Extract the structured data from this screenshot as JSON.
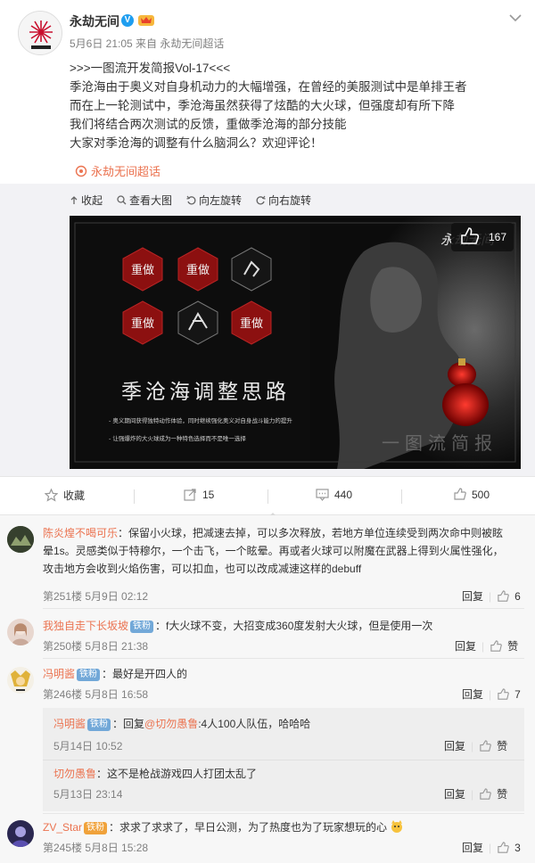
{
  "post": {
    "author": "永劫无间",
    "verified": "V",
    "meta": "5月6日 21:05 来自 永劫无间超话",
    "lines": [
      ">>>一图流开发简报Vol-17<<<",
      "季沧海由于奥义对自身机动力的大幅增强，在曾经的美服测试中是单排王者",
      "而在上一轮测试中，季沧海虽然获得了炫酷的大火球，但强度却有所下降",
      "我们将结合两次测试的反馈，重做季沧海的部分技能",
      "大家对季沧海的调整有什么脑洞么？欢迎评论！"
    ],
    "chaohua_link": "永劫无间超话"
  },
  "media": {
    "tools": [
      "收起",
      "查看大图",
      "向左旋转",
      "向右旋转"
    ],
    "like_count": "167",
    "badges": [
      "重做",
      "重做",
      "重做",
      "重做"
    ],
    "image_title": "季沧海调整思路",
    "bullets": [
      "- 奥义期间获得独特动作体验，同时继续强化奥义对自身战斗能力的提升",
      "- 让强爆炸的大火球成为一种特色选择而不是唯一选择"
    ],
    "watermark": "一图流简报",
    "logo_text": "永劫无间"
  },
  "actions": {
    "collect": "收藏",
    "forward": "15",
    "comment": "440",
    "like": "500"
  },
  "comments": [
    {
      "user": "陈炎煌不喝可乐",
      "text": "：保留小火球，把减速去掉，可以多次释放，若地方单位连续受到两次命中则被眩晕1s。灵感类似于特穆尔，一个击飞，一个眩晕。再或者火球可以附魔在武器上得到火属性强化，攻击地方会收到火焰伤害，可以扣血，也可以改成减速这样的debuff",
      "lines": [
        "：保留小火球，把减速去掉，可以多次释放，若地方单位连续受到两次命中则被眩",
        "晕1s。灵感类似于特穆尔，一个击飞，一个眩晕。再或者火球可以附魔在武器上得到火属性强化，",
        "攻击地方会收到火焰伤害，可以扣血，也可以改成减速这样的debuff"
      ],
      "floor": "第251楼 5月9日 02:12",
      "reply": "回复",
      "likes": "6"
    },
    {
      "user": "我独自走下长坂坡",
      "badge": "铁粉",
      "text": "：f大火球不变，大招变成360度发射大火球，但是使用一次",
      "floor": "第250楼 5月8日 21:38",
      "reply": "回复",
      "likes": "赞"
    },
    {
      "user": "冯明酱",
      "badge": "铁粉",
      "text": "：最好是开四人的",
      "floor": "第246楼 5月8日 16:58",
      "reply": "回复",
      "likes": "7"
    },
    {
      "user": "ZV_Star",
      "badge": "铁粉",
      "text": "：求求了求求了，早日公测，为了热度也为了玩家想玩的心",
      "floor": "第245楼 5月8日 15:28",
      "reply": "回复",
      "likes": "3"
    }
  ],
  "replies": [
    {
      "user": "冯明酱",
      "badge": "铁粉",
      "prefix": "：回复",
      "mention": "@切勿愚鲁",
      "text": ":4人100人队伍，哈哈哈",
      "date": "5月14日 10:52",
      "reply": "回复",
      "likes": "赞"
    },
    {
      "user": "切勿愚鲁",
      "text": "：这不是枪战游戏四人打团太乱了",
      "date": "5月13日 23:14",
      "reply": "回复",
      "likes": "赞"
    }
  ]
}
